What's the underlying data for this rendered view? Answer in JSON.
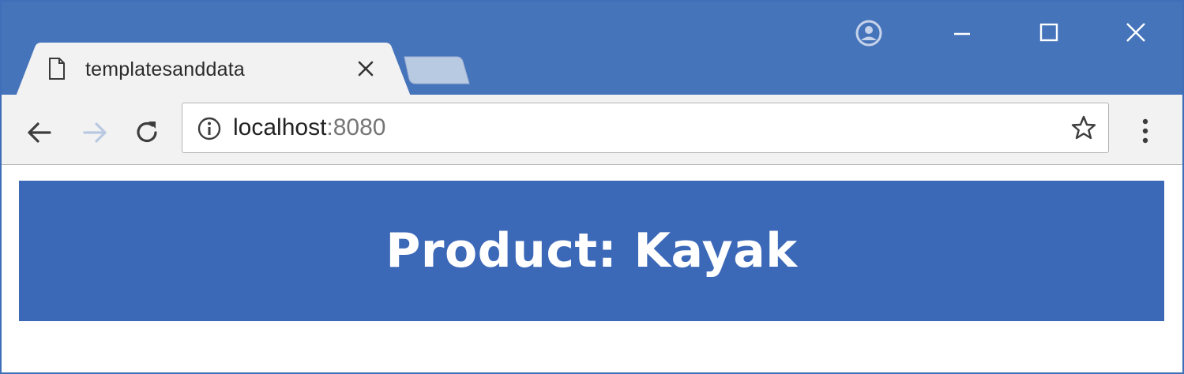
{
  "browser": {
    "tab": {
      "title": "templatesanddata"
    },
    "address_bar": {
      "host": "localhost",
      "port": ":8080"
    },
    "icons": {
      "page": "page-icon",
      "close": "close-icon",
      "back": "back-arrow-icon",
      "forward": "forward-arrow-icon",
      "reload": "reload-icon",
      "info": "info-icon",
      "star": "star-icon",
      "menu": "kebab-menu-icon",
      "profile": "profile-icon",
      "minimize": "minimize-icon",
      "maximize": "maximize-icon",
      "window_close": "window-close-icon"
    },
    "colors": {
      "titlebar": "#4674bb",
      "toolbar": "#f2f2f2"
    }
  },
  "page": {
    "heading": "Product: Kayak",
    "banner_color": "#3c68b8",
    "heading_color": "#ffffff"
  }
}
